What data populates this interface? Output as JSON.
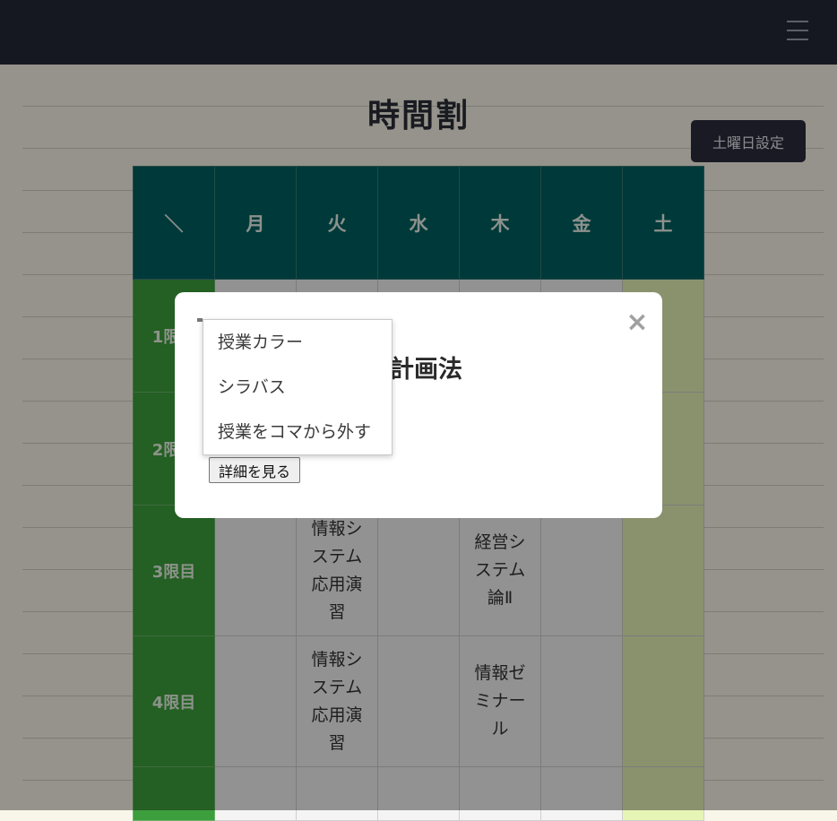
{
  "page": {
    "title": "時間割"
  },
  "toolbar": {
    "saturday_settings_label": "土曜日設定"
  },
  "timetable": {
    "corner": "＼",
    "days": [
      "月",
      "火",
      "水",
      "木",
      "金",
      "土"
    ],
    "periods": [
      {
        "label": "1限目",
        "cells": [
          "",
          "",
          "",
          "",
          "",
          ""
        ]
      },
      {
        "label": "2限目",
        "cells": [
          "",
          "",
          "",
          "",
          "",
          ""
        ]
      },
      {
        "label": "3限目",
        "cells": [
          "",
          "情報システム応用演習",
          "",
          "経営システム論Ⅱ",
          "",
          ""
        ]
      },
      {
        "label": "4限目",
        "cells": [
          "",
          "情報システム応用演習",
          "",
          "情報ゼミナール",
          "",
          ""
        ]
      },
      {
        "label": "",
        "cells": [
          "",
          "",
          "",
          "",
          "",
          ""
        ]
      }
    ]
  },
  "modal": {
    "title_visible": "計画法",
    "close_icon": "×",
    "detail_button_label": "詳細を見る"
  },
  "context_menu": {
    "items": [
      "授業カラー",
      "シラバス",
      "授業をコマから外す"
    ]
  },
  "colors": {
    "navbar": "#252938",
    "header_row": "#006060",
    "period_column": "#3d9e3d",
    "saturday_column": "#e6f4b6"
  }
}
